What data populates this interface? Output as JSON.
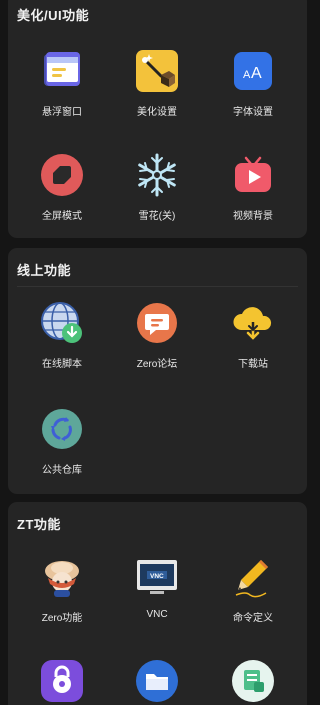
{
  "sections": [
    {
      "title": "美化/UI功能",
      "items": [
        {
          "label": "悬浮窗口",
          "icon": "floating-window-icon"
        },
        {
          "label": "美化设置",
          "icon": "magic-wand-icon"
        },
        {
          "label": "字体设置",
          "icon": "font-icon"
        },
        {
          "label": "全屏模式",
          "icon": "fullscreen-icon"
        },
        {
          "label": "雪花(关)",
          "icon": "snowflake-icon"
        },
        {
          "label": "视频背景",
          "icon": "video-tv-icon"
        }
      ]
    },
    {
      "title": "线上功能",
      "items": [
        {
          "label": "在线脚本",
          "icon": "globe-download-icon"
        },
        {
          "label": "Zero论坛",
          "icon": "forum-chat-icon"
        },
        {
          "label": "下载站",
          "icon": "cloud-download-icon"
        },
        {
          "label": "公共仓库",
          "icon": "recycle-repository-icon"
        }
      ]
    },
    {
      "title": "ZT功能",
      "items": [
        {
          "label": "Zero功能",
          "icon": "zero-mascot-icon"
        },
        {
          "label": "VNC",
          "icon": "vnc-monitor-icon"
        },
        {
          "label": "命令定义",
          "icon": "pencil-icon"
        },
        {
          "label": "",
          "icon": "lock-app-icon"
        },
        {
          "label": "",
          "icon": "folder-icon"
        },
        {
          "label": "",
          "icon": "document-app-icon"
        }
      ]
    }
  ],
  "colors": {
    "background": "#151515",
    "card": "#252525",
    "text": "#f0f0f0"
  }
}
